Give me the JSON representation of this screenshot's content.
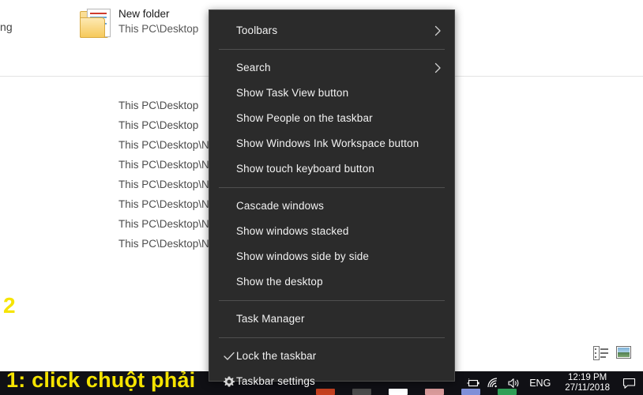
{
  "explorer": {
    "clipped_left_text": "ng",
    "folder_entry": {
      "name": "New folder",
      "path": "This PC\\Desktop",
      "icon": "folder-icon"
    },
    "result_paths": [
      "This PC\\Desktop",
      "This PC\\Desktop",
      "This PC\\Desktop\\Nev",
      "This PC\\Desktop\\Nev",
      "This PC\\Desktop\\Nev",
      "This PC\\Desktop\\Nev",
      "This PC\\Desktop\\Nev",
      "This PC\\Desktop\\Nev"
    ],
    "view_buttons": [
      {
        "name": "details-view-icon",
        "tooltip": "Details"
      },
      {
        "name": "large-icons-view-icon",
        "tooltip": "Large icons"
      }
    ]
  },
  "context_menu": {
    "items": [
      {
        "label": "Toolbars",
        "submenu": true,
        "lead": "none",
        "sep_after": true
      },
      {
        "label": "Search",
        "submenu": true,
        "lead": "none",
        "sep_after": false
      },
      {
        "label": "Show Task View button",
        "submenu": false,
        "lead": "none",
        "sep_after": false
      },
      {
        "label": "Show People on the taskbar",
        "submenu": false,
        "lead": "none",
        "sep_after": false
      },
      {
        "label": "Show Windows Ink Workspace button",
        "submenu": false,
        "lead": "none",
        "sep_after": false
      },
      {
        "label": "Show touch keyboard button",
        "submenu": false,
        "lead": "none",
        "sep_after": true
      },
      {
        "label": "Cascade windows",
        "submenu": false,
        "lead": "none",
        "sep_after": false
      },
      {
        "label": "Show windows stacked",
        "submenu": false,
        "lead": "none",
        "sep_after": false
      },
      {
        "label": "Show windows side by side",
        "submenu": false,
        "lead": "none",
        "sep_after": false
      },
      {
        "label": "Show the desktop",
        "submenu": false,
        "lead": "none",
        "sep_after": true
      },
      {
        "label": "Task Manager",
        "submenu": false,
        "lead": "none",
        "sep_after": true
      },
      {
        "label": "Lock the taskbar",
        "submenu": false,
        "lead": "check",
        "sep_after": false
      },
      {
        "label": "Taskbar settings",
        "submenu": false,
        "lead": "gear",
        "sep_after": false
      }
    ],
    "background_color": "#2b2b2b",
    "text_color": "#f2f2f2"
  },
  "annotations": {
    "step1": "1: click chuột phải",
    "step2": "2",
    "color": "#f6e400"
  },
  "taskbar": {
    "tray": {
      "battery_icon": "battery-icon",
      "network_icon": "wifi-icon",
      "volume_icon": "speaker-icon",
      "language": "ENG",
      "time": "12:19 PM",
      "date": "27/11/2018",
      "action_center_icon": "notification-icon"
    },
    "app_colors": [
      "#c4401f",
      "#4a4a4a",
      "#ffffff",
      "#d89a9a",
      "#7f8fd8",
      "#2f9e56"
    ]
  }
}
